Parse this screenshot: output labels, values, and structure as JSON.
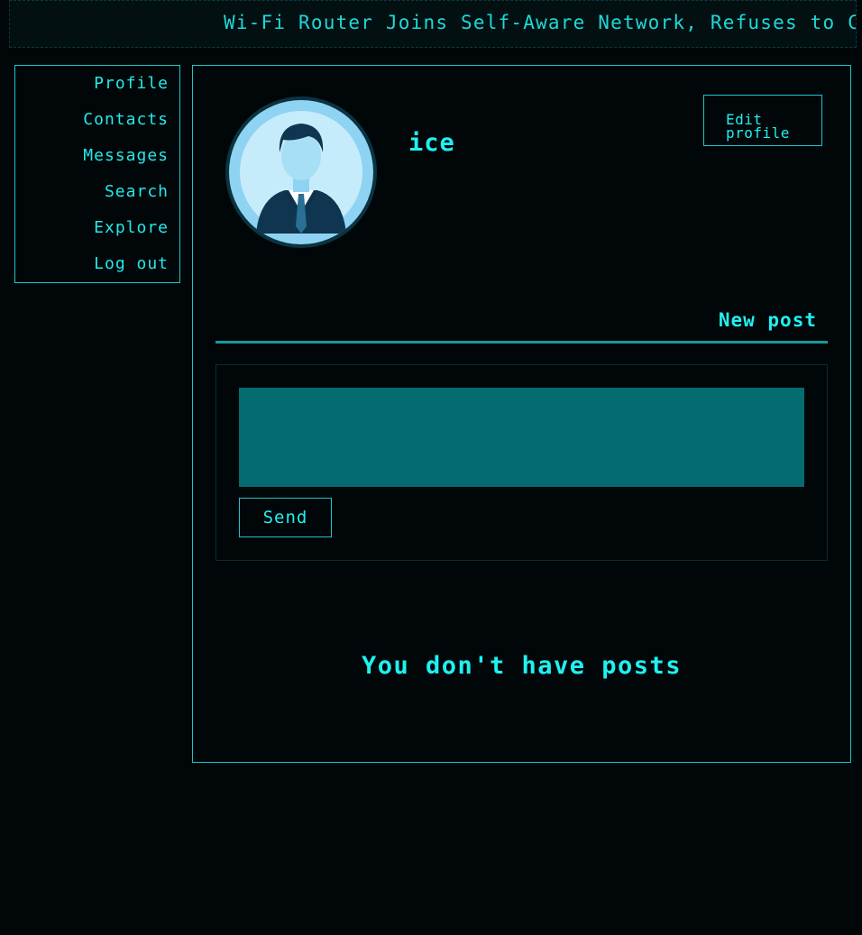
{
  "ticker": {
    "text": "Wi-Fi Router Joins Self-Aware Network, Refuses to Connect"
  },
  "sidebar": {
    "items": [
      {
        "label": "Profile"
      },
      {
        "label": "Contacts"
      },
      {
        "label": "Messages"
      },
      {
        "label": "Search"
      },
      {
        "label": "Explore"
      },
      {
        "label": "Log out"
      }
    ]
  },
  "profile": {
    "avatar_icon": "user-avatar-icon",
    "username": "ice",
    "edit_button_label": "Edit profile"
  },
  "composer": {
    "tab_label": "New post",
    "input_value": "",
    "send_label": "Send"
  },
  "posts": {
    "empty_message": "You don't have posts"
  },
  "colors": {
    "background": "#010709",
    "accent": "#20f0f0",
    "border": "#1fc4c8",
    "input_fill": "#046c70"
  }
}
